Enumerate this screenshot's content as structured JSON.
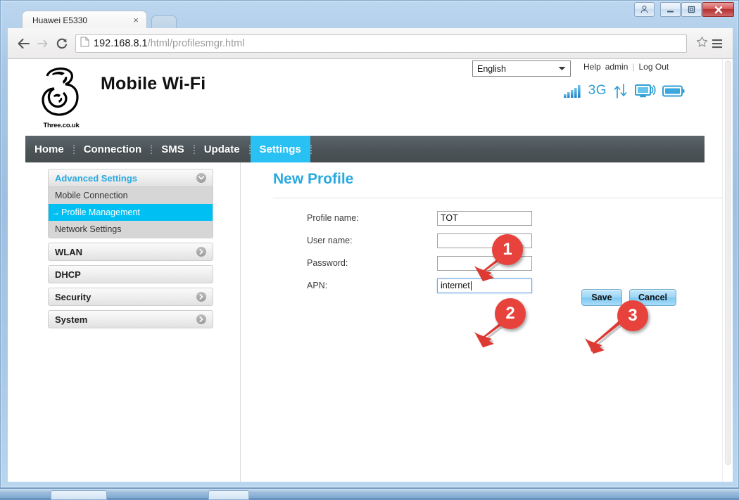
{
  "window": {
    "controls": [
      {
        "name": "user-account",
        "icon": "user-icon"
      },
      {
        "name": "minimize",
        "icon": "minimize-icon"
      },
      {
        "name": "maximize",
        "icon": "maximize-icon"
      },
      {
        "name": "close",
        "icon": "close-icon"
      }
    ]
  },
  "browser": {
    "tab_title": "Huawei E5330",
    "tab_close": "×",
    "url_host": "192.168.8.1",
    "url_path": "/html/profilesmgr.html",
    "back_icon": "back-arrow-icon",
    "forward_icon": "forward-arrow-icon",
    "reload_icon": "reload-icon",
    "page_icon": "page-document-icon",
    "star_icon": "bookmark-star-icon",
    "menu_icon": "hamburger-menu-icon"
  },
  "header": {
    "brand_title": "Mobile Wi-Fi",
    "logo_caption": "Three.co.uk",
    "logo_icon": "three-logo-icon",
    "language": {
      "selected": "English",
      "options": [
        "English"
      ]
    },
    "links": {
      "help": "Help",
      "user": "admin",
      "separator": "|",
      "logout": "Log Out"
    },
    "status": {
      "signal_icon": "signal-bars-icon",
      "network_label": "3G",
      "transfer_icon": "up-down-transfer-icon",
      "device_icon": "connected-device-icon",
      "battery_icon": "battery-icon"
    }
  },
  "nav": {
    "items": [
      {
        "label": "Home",
        "active": false
      },
      {
        "label": "Connection",
        "active": false
      },
      {
        "label": "SMS",
        "active": false
      },
      {
        "label": "Update",
        "active": false
      },
      {
        "label": "Settings",
        "active": true
      }
    ]
  },
  "sidebar": {
    "groups": [
      {
        "label": "Advanced Settings",
        "expanded": true,
        "chevron": "chevron-down-icon",
        "items": [
          {
            "label": "Mobile Connection",
            "active": false
          },
          {
            "label": "Profile Management",
            "active": true,
            "arrow": "→"
          },
          {
            "label": "Network Settings",
            "active": false
          }
        ]
      },
      {
        "label": "WLAN",
        "expanded": false,
        "chevron": "chevron-right-icon",
        "items": []
      },
      {
        "label": "DHCP",
        "expanded": false,
        "chevron": "",
        "items": []
      },
      {
        "label": "Security",
        "expanded": false,
        "chevron": "chevron-right-icon",
        "items": []
      },
      {
        "label": "System",
        "expanded": false,
        "chevron": "chevron-right-icon",
        "items": []
      }
    ]
  },
  "panel": {
    "title": "New Profile",
    "fields": [
      {
        "label": "Profile name:",
        "value": "TOT",
        "focused": false,
        "placeholder": ""
      },
      {
        "label": "User name:",
        "value": "",
        "focused": false,
        "placeholder": ""
      },
      {
        "label": "Password:",
        "value": "",
        "focused": false,
        "placeholder": ""
      },
      {
        "label": "APN:",
        "value": "internet",
        "focused": true,
        "placeholder": ""
      }
    ],
    "buttons": {
      "save": "Save",
      "cancel": "Cancel"
    }
  },
  "annotations": [
    {
      "number": "1",
      "target": "profile-name-field"
    },
    {
      "number": "2",
      "target": "apn-field"
    },
    {
      "number": "3",
      "target": "save-button"
    }
  ],
  "colors": {
    "accent_cyan": "#00bff3",
    "nav_dark": "#4c5458",
    "heading_blue": "#29a9e0",
    "callout_red": "#e8423c",
    "status_blue": "#2f9fd6"
  }
}
